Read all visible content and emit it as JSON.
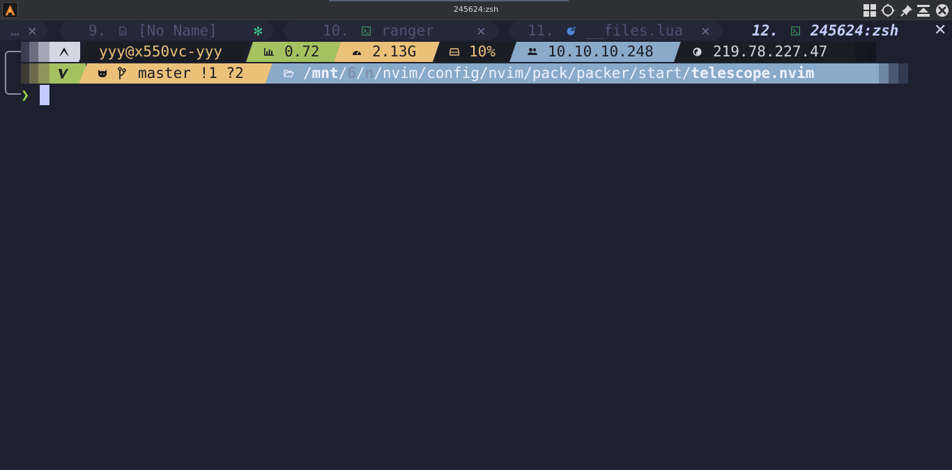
{
  "window": {
    "title": "245624:zsh"
  },
  "tabs": [
    {
      "index": "",
      "label": "…",
      "close": "✕",
      "state": "inactive"
    },
    {
      "index": "9.",
      "label": "[No Name]",
      "modified_mark": "✻",
      "state": "inactive"
    },
    {
      "index": "10.",
      "label": "ranger",
      "close": "✕",
      "state": "inactive"
    },
    {
      "index": "11.",
      "label": "__files.lua",
      "close": "✕",
      "state": "inactive"
    },
    {
      "index": "12.",
      "label": "245624:zsh",
      "state": "active"
    }
  ],
  "tabbar_close": "✕",
  "prompt": {
    "line1": {
      "os_icon": "arch-linux-icon",
      "user_host": "yyy@x550vc-yyy",
      "load": "0.72",
      "ram": "2.13G",
      "disk": "10%",
      "local_ip": "10.10.10.248",
      "public_ip": "219.78.227.47"
    },
    "line2": {
      "vi_mode": "V",
      "vcs_branch": "master !1 ?2",
      "path_parts": [
        "/",
        "mnt",
        "/",
        "6",
        "/",
        "n",
        "/nvim/config/nvim/pack/packer/start/",
        "telescope.nvim"
      ]
    },
    "input_char": "❯"
  },
  "colors": {
    "background": "#1e2030",
    "segment_light_gray": "#d4d7e2",
    "segment_dark": "#1b1d25",
    "segment_green": "#a5c261",
    "segment_yellow": "#ebc17a",
    "segment_blue": "#89aac8",
    "prompt_green": "#9ad84a"
  }
}
